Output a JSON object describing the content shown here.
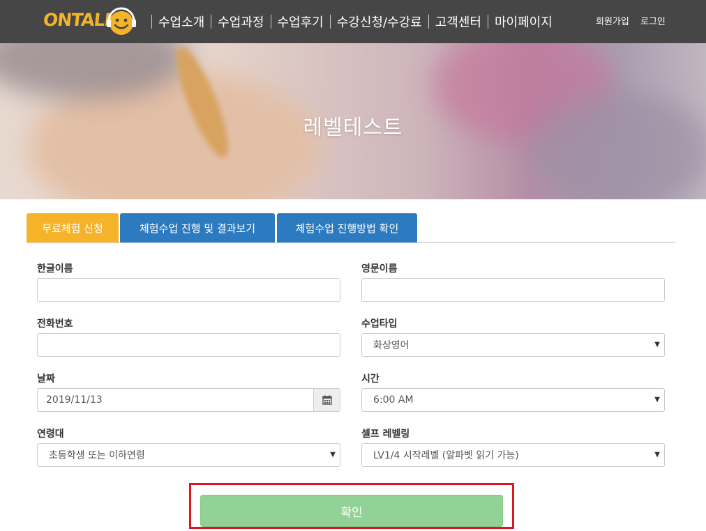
{
  "nav": {
    "logo_text": "ONTALK",
    "menu": [
      "수업소개",
      "수업과정",
      "수업후기",
      "수강신청/수강료",
      "고객센터",
      "마이페이지"
    ],
    "signup": "회원가입",
    "login": "로그인"
  },
  "hero": {
    "title": "레벨테스트"
  },
  "tabs": [
    "무료체험 신청",
    "체험수업 진행 및 결과보기",
    "체험수업 진행방법 확인"
  ],
  "form": {
    "korean_name_label": "한글이름",
    "korean_name_value": "",
    "english_name_label": "영문이름",
    "english_name_value": "",
    "phone_label": "전화번호",
    "phone_value": "",
    "class_type_label": "수업타입",
    "class_type_value": "화상영어",
    "date_label": "날짜",
    "date_value": "2019/11/13",
    "time_label": "시간",
    "time_value": "6:00 AM",
    "age_label": "연령대",
    "age_value": "초등학생 또는 이하연령",
    "self_level_label": "셀프 레벨링",
    "self_level_value": "LV1/4 시작레벨 (알파벳 읽기 가능)"
  },
  "submit_label": "확인",
  "colors": {
    "nav_bg": "#464646",
    "logo": "#f5b32a",
    "tab_active": "#f5b32a",
    "tab_inactive": "#2c7bc0",
    "submit": "#93d296",
    "highlight": "#e0141e"
  },
  "icons": {
    "calendar": "calendar-icon",
    "select_arrow": "caret-down-icon"
  }
}
